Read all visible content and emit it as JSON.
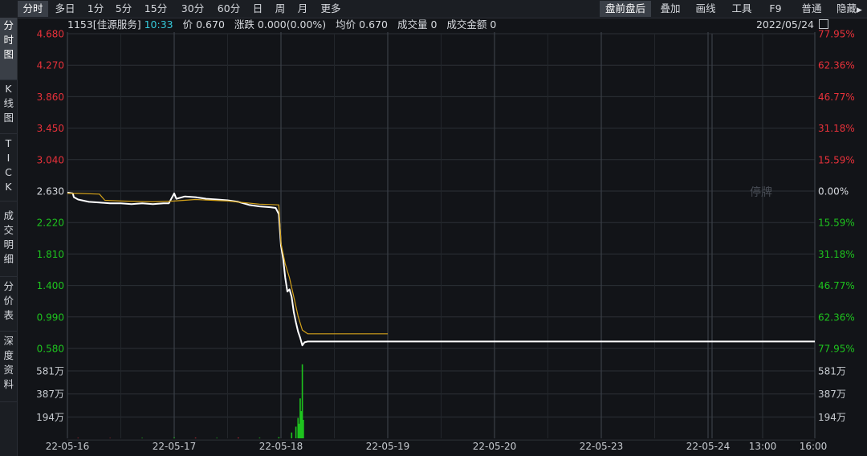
{
  "toolbar": {
    "left": [
      {
        "label": "分时",
        "active": true
      },
      {
        "label": "多日",
        "active": false
      },
      {
        "label": "1分",
        "active": false
      },
      {
        "label": "5分",
        "active": false
      },
      {
        "label": "15分",
        "active": false
      },
      {
        "label": "30分",
        "active": false
      },
      {
        "label": "60分",
        "active": false
      },
      {
        "label": "日",
        "active": false
      },
      {
        "label": "周",
        "active": false
      },
      {
        "label": "月",
        "active": false
      },
      {
        "label": "更多",
        "active": false
      }
    ],
    "right": [
      {
        "label": "盘前盘后",
        "active": true
      },
      {
        "label": "叠加",
        "active": false
      },
      {
        "label": "画线",
        "active": false
      },
      {
        "label": "工具",
        "active": false
      },
      {
        "label": "F9",
        "active": false
      },
      {
        "label": "普通",
        "active": false
      },
      {
        "label": "隐藏",
        "active": false
      }
    ],
    "hide_icon": "triangle-right-icon"
  },
  "sidebar": {
    "tabs": [
      {
        "label": "分时图",
        "active": true
      },
      {
        "label": "K线图",
        "active": false
      },
      {
        "label": "TICK",
        "active": false
      },
      {
        "label": "成交明细",
        "active": false
      },
      {
        "label": "分价表",
        "active": false
      },
      {
        "label": "深度资料",
        "active": false
      }
    ]
  },
  "info": {
    "code_name": "1153[佳源服务]",
    "time": "10:33",
    "price_label": "价",
    "price": "0.670",
    "change_label": "涨跌",
    "change": "0.000(0.00%)",
    "avg_label": "均价",
    "avg": "0.670",
    "volume_label": "成交量",
    "volume": "0",
    "amount_label": "成交金额",
    "amount": "0",
    "date": "2022/05/24"
  },
  "colors": {
    "up": "#e8313a",
    "down": "#1ec41e",
    "neutral": "#d7dadf",
    "price_line": "#ffffff",
    "avg_line": "#d4a21a",
    "grid": "#2c3036"
  },
  "chart_data": {
    "type": "line",
    "title": "",
    "prev_close": 2.63,
    "ylim": [
      0.58,
      4.68
    ],
    "price_ticks_up": [
      "4.680",
      "4.270",
      "3.860",
      "3.450",
      "3.040"
    ],
    "price_tick_mid": "2.630",
    "price_ticks_down": [
      "2.220",
      "1.810",
      "1.400",
      "0.990",
      "0.580"
    ],
    "pct_ticks_up": [
      "77.95%",
      "62.36%",
      "46.77%",
      "31.18%",
      "15.59%"
    ],
    "pct_tick_mid": "0.00%",
    "pct_ticks_down": [
      "15.59%",
      "31.18%",
      "46.77%",
      "62.36%",
      "77.95%"
    ],
    "volume_ticks": [
      "581万",
      "387万",
      "194万"
    ],
    "days": [
      "22-05-16",
      "22-05-17",
      "22-05-18",
      "22-05-19",
      "22-05-20",
      "22-05-23",
      "22-05-24"
    ],
    "last_day_ticks": [
      "13:00",
      "16:00"
    ],
    "suspended_label": "停牌",
    "x_domain": [
      0,
      7
    ],
    "series": [
      {
        "key": "price",
        "x": [
          0,
          0.05,
          0.06,
          0.1,
          0.2,
          0.3,
          0.4,
          0.5,
          0.6,
          0.7,
          0.8,
          0.9,
          0.95,
          1.0,
          1.02,
          1.1,
          1.2,
          1.3,
          1.4,
          1.5,
          1.6,
          1.7,
          1.8,
          1.9,
          1.95,
          1.98,
          2.0,
          2.02,
          2.04,
          2.06,
          2.08,
          2.1,
          2.12,
          2.14,
          2.16,
          2.18,
          2.2,
          2.22,
          2.25,
          2.3,
          2.5,
          3.0,
          4.0,
          5.0,
          6.0,
          6.9,
          7.0
        ],
        "y": [
          2.61,
          2.6,
          2.55,
          2.52,
          2.49,
          2.48,
          2.47,
          2.47,
          2.46,
          2.47,
          2.46,
          2.47,
          2.47,
          2.6,
          2.53,
          2.56,
          2.55,
          2.53,
          2.52,
          2.51,
          2.49,
          2.45,
          2.43,
          2.42,
          2.41,
          2.33,
          1.92,
          1.75,
          1.5,
          1.32,
          1.35,
          1.25,
          1.05,
          0.92,
          0.8,
          0.72,
          0.62,
          0.66,
          0.67,
          0.67,
          0.67,
          0.67,
          0.67,
          0.67,
          0.67,
          0.67,
          0.67
        ]
      },
      {
        "key": "avg",
        "x": [
          0,
          0.1,
          0.3,
          0.35,
          0.5,
          0.8,
          1.0,
          1.2,
          1.5,
          1.8,
          1.98,
          2.0,
          2.04,
          2.08,
          2.12,
          2.16,
          2.2,
          2.25,
          3.0
        ],
        "y": [
          2.6,
          2.6,
          2.59,
          2.51,
          2.5,
          2.49,
          2.5,
          2.52,
          2.5,
          2.46,
          2.45,
          1.95,
          1.68,
          1.5,
          1.25,
          1.0,
          0.82,
          0.77,
          0.77
        ]
      }
    ],
    "volume": {
      "ylim": [
        0,
        7750000
      ],
      "x": [
        0.1,
        0.4,
        0.7,
        1.0,
        1.2,
        1.4,
        1.6,
        1.8,
        1.98,
        2.1,
        2.14,
        2.16,
        2.18,
        2.2
      ],
      "values": [
        40000,
        30000,
        50000,
        90000,
        60000,
        50000,
        70000,
        60000,
        120000,
        600000,
        1200000,
        2100000,
        4100000,
        7600000
      ],
      "up": [
        false,
        false,
        true,
        true,
        false,
        true,
        false,
        true,
        true,
        true,
        true,
        true,
        true,
        true
      ]
    }
  }
}
